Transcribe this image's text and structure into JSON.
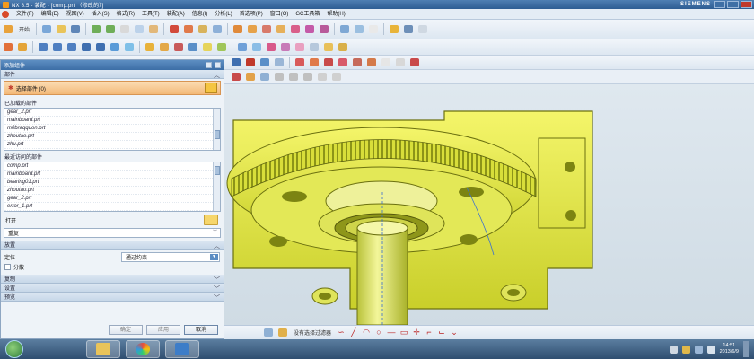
{
  "window": {
    "title": "NX 8.5 - 装配 - [comp.prt （修改的）]",
    "brand": "SIEMENS"
  },
  "menubar": {
    "items": [
      "文件(F)",
      "编辑(E)",
      "视图(V)",
      "插入(S)",
      "格式(R)",
      "工具(T)",
      "装配(A)",
      "信息(I)",
      "分析(L)",
      "首选项(P)",
      "窗口(O)",
      "GC工具箱",
      "帮助(H)"
    ]
  },
  "toolbar": {
    "start_label": "开始",
    "snap_label": "没有选择过滤器"
  },
  "panel": {
    "title": "添加组件",
    "section_part": "部件",
    "select_part_label": "选择部件 (0)",
    "loaded_label": "已加载的部件",
    "loaded_parts": [
      "gear_2.prt",
      "mainboard.prt",
      "m0braqquon.prt",
      "zhoutao.prt",
      "zhu.prt"
    ],
    "recent_label": "最近访问的部件",
    "recent_parts": [
      "comp.prt",
      "mainboard.prt",
      "bearing01.prt",
      "zhoutao.prt",
      "gear_2.prt",
      "error_1.prt"
    ],
    "open_label": "打开",
    "repeat_label": "重复",
    "section_place": "放置",
    "position_label": "定位",
    "position_value": "通过约束",
    "scatter_label": "分散",
    "section_copy": "复制",
    "section_settings": "设置",
    "section_preview": "预览",
    "btn_ok": "确定",
    "btn_apply": "应用",
    "btn_cancel": "取消"
  },
  "taskbar": {
    "time": "14:51",
    "date": "2013/6/9"
  }
}
